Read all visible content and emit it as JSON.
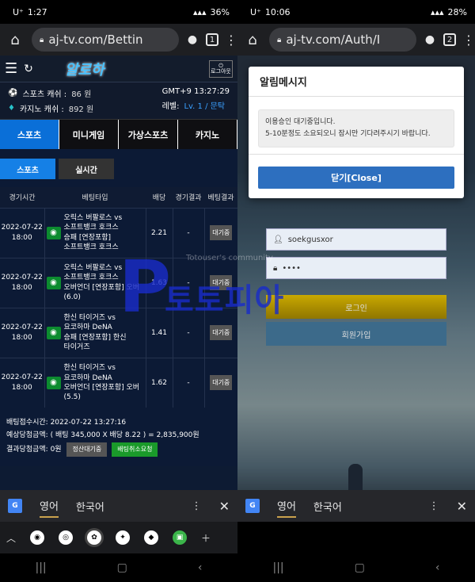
{
  "left": {
    "status": {
      "carrier": "U⁺",
      "time": "1:27",
      "battery": "36%"
    },
    "url": "aj-tv.com/Bettin",
    "tab_count": "1",
    "site": {
      "logo": "알로하",
      "logout": "로그아웃",
      "sports_cash_label": "스포츠 캐쉬 :",
      "sports_cash_value": "86 원",
      "casino_cash_label": "카지노 캐쉬 :",
      "casino_cash_value": "892 원",
      "gmt": "GMT+9 13:27:29",
      "level_label": "레벨:",
      "level_value": "Lv. 1 / 문탁",
      "categories": [
        "스포츠",
        "미니게임",
        "가상스포츠",
        "카지노"
      ],
      "subtabs": [
        "스포츠",
        "실시간"
      ],
      "table_headers": [
        "경기시간",
        "베팅타입",
        "배당",
        "경기결과",
        "베팅결과"
      ],
      "rows": [
        {
          "date": "2022-07-22",
          "time": "18:00",
          "bet_line1": "오릭스 버팔로스 vs",
          "bet_line2": "소프트뱅크 호크스",
          "bet_line3": "승패 [연장포함]",
          "bet_line4": "소프트뱅크 호크스",
          "odds": "2.21",
          "result": "-",
          "status": "대기중"
        },
        {
          "date": "2022-07-22",
          "time": "18:00",
          "bet_line1": "오릭스 버팔로스 vs",
          "bet_line2": "소프트뱅크 호크스",
          "bet_line3": "오버언더 [연장포함] 오버",
          "bet_line4": "(6.0)",
          "odds": "1.63",
          "result": "-",
          "status": "대기중"
        },
        {
          "date": "2022-07-22",
          "time": "18:00",
          "bet_line1": "한신 타이거즈 vs",
          "bet_line2": "요코하마 DeNA",
          "bet_line3": "승패 [연장포함] 한신",
          "bet_line4": "타이거즈",
          "odds": "1.41",
          "result": "-",
          "status": "대기중"
        },
        {
          "date": "2022-07-22",
          "time": "18:00",
          "bet_line1": "한신 타이거즈 vs",
          "bet_line2": "요코하마 DeNA",
          "bet_line3": "오버언더 [연장포함] 오버",
          "bet_line4": "(5.5)",
          "odds": "1.62",
          "result": "-",
          "status": "대기중"
        }
      ],
      "summary_time": "배팅접수시간: 2022-07-22 13:27:16",
      "summary_expected": "예상당첨금액: ( 배팅 345,000 X 배당 8.22 ) = 2,835,900원",
      "summary_result": "결과당첨금액: 0원",
      "btn_settle": "정산대기중",
      "btn_cancel": "배팅취소요청"
    },
    "watermark": {
      "letter": "P",
      "text": "토토피아",
      "small": "Totouser's community"
    },
    "translate": {
      "icon": "G",
      "lang1": "영어",
      "lang2": "한국어"
    }
  },
  "right": {
    "status": {
      "carrier": "U⁺",
      "time": "10:06",
      "battery": "28%"
    },
    "url": "aj-tv.com/Auth/I",
    "tab_count": "2",
    "modal": {
      "title": "알림메시지",
      "message_line1": "이용승인 대기중입니다.",
      "message_line2": "5-10분정도 소요되오니 잠시만 기다려주시기 바랍니다.",
      "close_label": "닫기[Close]"
    },
    "login": {
      "username": "soekgusxor",
      "password": "••••",
      "login_label": "로그인",
      "join_label": "회원가입"
    },
    "translate": {
      "icon": "G",
      "lang1": "영어",
      "lang2": "한국어"
    }
  }
}
